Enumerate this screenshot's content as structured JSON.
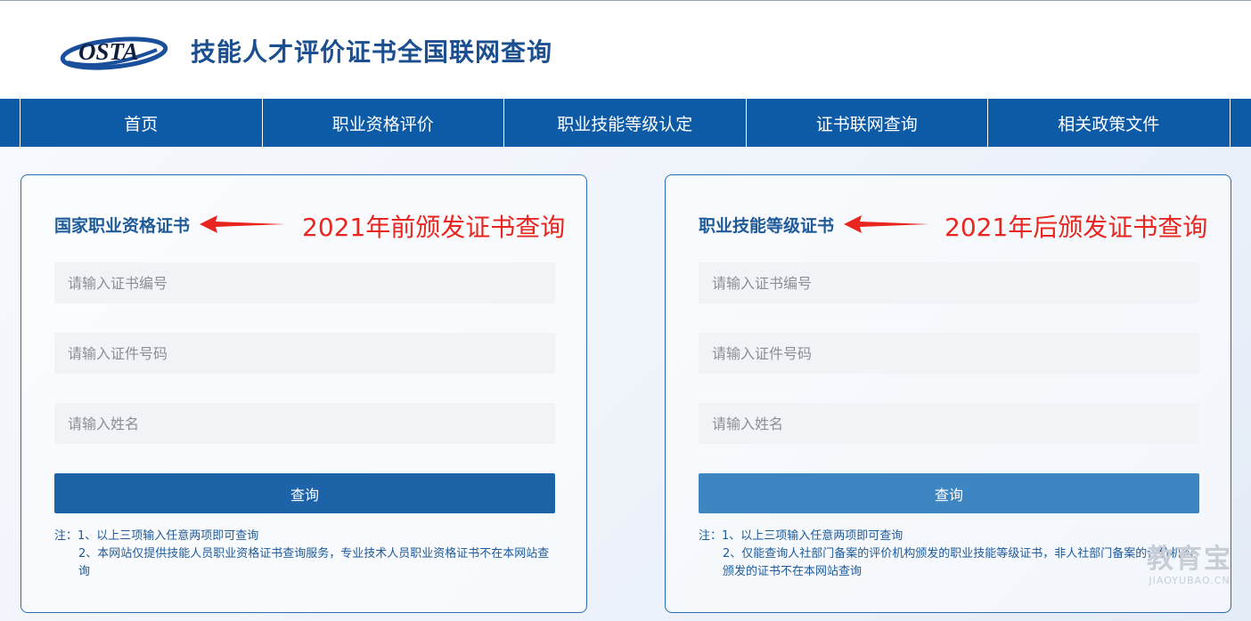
{
  "header": {
    "logo_text": "OSTA",
    "site_title": "技能人才评价证书全国联网查询"
  },
  "nav": {
    "items": [
      {
        "label": "首页"
      },
      {
        "label": "职业资格评价"
      },
      {
        "label": "职业技能等级认定"
      },
      {
        "label": "证书联网查询"
      },
      {
        "label": "相关政策文件"
      }
    ]
  },
  "panels": {
    "left": {
      "title": "国家职业资格证书",
      "annotation": "2021年前颁发证书查询",
      "cert_no_placeholder": "请输入证书编号",
      "id_no_placeholder": "请输入证件号码",
      "name_placeholder": "请输入姓名",
      "button_label": "查询",
      "note_line1": "注：1、以上三项输入任意两项即可查询",
      "note_line2": "2、本网站仅提供技能人员职业资格证书查询服务，专业技术人员职业资格证书不在本网站查询"
    },
    "right": {
      "title": "职业技能等级证书",
      "annotation": "2021年后颁发证书查询",
      "cert_no_placeholder": "请输入证书编号",
      "id_no_placeholder": "请输入证件号码",
      "name_placeholder": "请输入姓名",
      "button_label": "查询",
      "note_line1": "注：1、以上三项输入任意两项即可查询",
      "note_line2": "2、仅能查询人社部门备案的评价机构颁发的职业技能等级证书，非人社部门备案的评价机构颁发的证书不在本网站查询"
    }
  },
  "watermark": {
    "main": "教育宝",
    "sub": "JIAOYUBAO.CN"
  },
  "colors": {
    "nav_bg": "#0d5aa6",
    "title_blue": "#1f5b98",
    "annotation_red": "#e8261f",
    "button_left": "#1d63a7",
    "button_right": "#3d86c2"
  }
}
